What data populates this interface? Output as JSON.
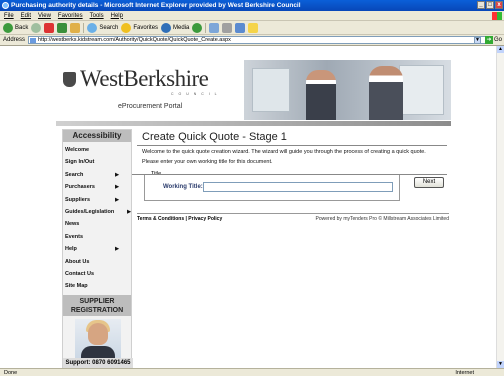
{
  "window": {
    "title": "Purchasing authority details - Microsoft Internet Explorer provided by West Berkshire Council",
    "minimize": "_",
    "maximize": "□",
    "close": "x"
  },
  "menu": [
    "File",
    "Edit",
    "View",
    "Favorites",
    "Tools",
    "Help"
  ],
  "toolbar": {
    "back": "Back",
    "search": "Search",
    "favorites": "Favorites",
    "media": "Media"
  },
  "address": {
    "label": "Address",
    "url": "http://westberks.kidstream.com/Authority/QuickQuote/QuickQuote_Create.aspx",
    "go": "Go"
  },
  "header": {
    "logo": "WestBerkshire",
    "logo_sub": "C O U N C I L",
    "portal": "eProcurement Portal"
  },
  "sidebar": {
    "heading": "Accessibility",
    "items": [
      {
        "label": "Welcome",
        "arrow": ""
      },
      {
        "label": "Sign In/Out",
        "arrow": ""
      },
      {
        "label": "Search",
        "arrow": "▶"
      },
      {
        "label": "Purchasers",
        "arrow": "▶"
      },
      {
        "label": "Suppliers",
        "arrow": "▶"
      },
      {
        "label": "Guides/Legislation",
        "arrow": "▶"
      },
      {
        "label": "News",
        "arrow": ""
      },
      {
        "label": "Events",
        "arrow": ""
      },
      {
        "label": "Help",
        "arrow": "▶"
      },
      {
        "label": "About Us",
        "arrow": ""
      },
      {
        "label": "Contact Us",
        "arrow": ""
      },
      {
        "label": "Site Map",
        "arrow": ""
      }
    ],
    "supplier_line1": "SUPPLIER",
    "supplier_line2": "REGISTRATION",
    "support": "Support: 0870 6091465"
  },
  "main": {
    "title": "Create Quick Quote - Stage 1",
    "intro": "Welcome to the quick quote creation wizard. The wizard will guide you through the process of creating a quick quote.",
    "prompt": "Please enter your own working title for this document.",
    "legend": "Title",
    "working_title_label": "Working Title:",
    "working_title_value": "",
    "next": "Next"
  },
  "footer": {
    "links": "Terms & Conditions  |  Privacy Policy",
    "powered": "Powered by myTenders Pro © Millstream Associates Limited"
  },
  "status": {
    "left": "Done",
    "zone": "Internet"
  }
}
